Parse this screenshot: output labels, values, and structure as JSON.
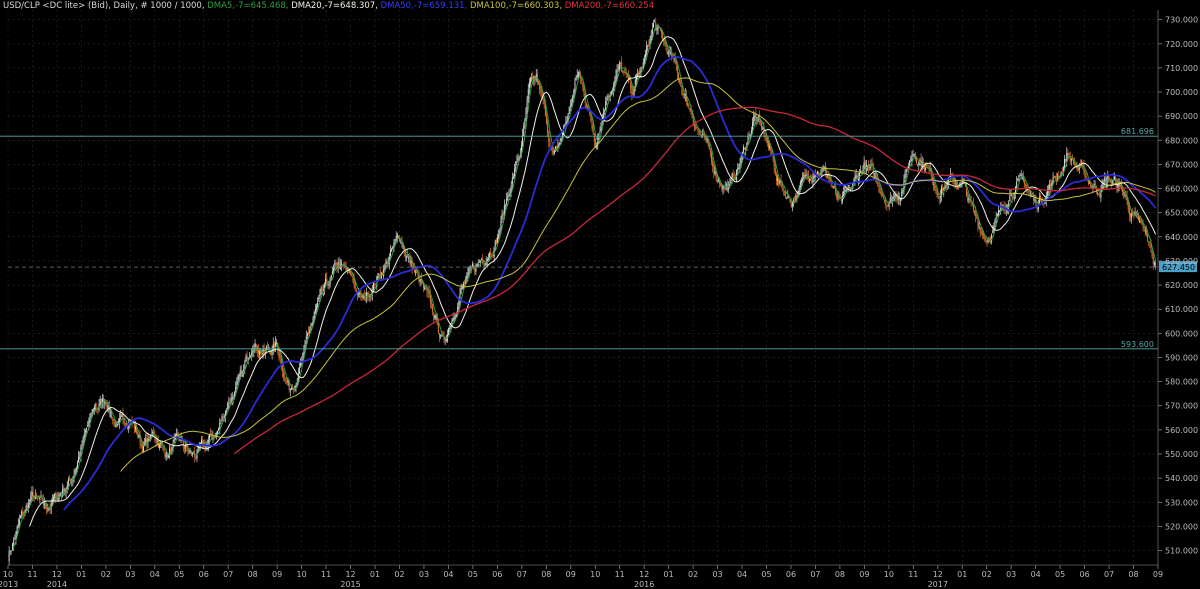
{
  "legend": {
    "title": "USD/CLP <DC lite> (Bid), Daily, # 1000 / 1000,",
    "dma5": "DMA5,-7=645.468,",
    "dma20": "DMA20,-7=648.307,",
    "dma50": "DMA50,-7=659.131,",
    "dma100": "DMA100,-7=660.303,",
    "dma200": "DMA200,-7=660.254"
  },
  "colors": {
    "background": "#000000",
    "grid": "#2a2a2a",
    "candle_up": "#d9d9d9",
    "candle_down": "#e07a2e",
    "dma5": "#2f9e3f",
    "dma20": "#f2f2e6",
    "dma50": "#2b2bd6",
    "dma100": "#c7c23a",
    "dma200": "#c8283a",
    "hline": "#5aa6a6",
    "last_price_box": "#4aa0c8"
  },
  "chart_data": {
    "type": "candlestick",
    "title": "USD/CLP <DC lite> (Bid), Daily",
    "y_ticks": [
      510,
      520,
      530,
      540,
      550,
      560,
      570,
      580,
      590,
      600,
      610,
      620,
      630,
      640,
      650,
      660,
      670,
      680,
      690,
      700,
      710,
      720,
      730
    ],
    "y_tick_labels": [
      "510.000",
      "520.000",
      "530.000",
      "540.000",
      "550.000",
      "560.000",
      "570.000",
      "580.000",
      "590.000",
      "600.000",
      "610.000",
      "620.000",
      "630.000",
      "640.000",
      "650.000",
      "660.000",
      "670.000",
      "680.000",
      "690.000",
      "700.000",
      "710.000",
      "720.000",
      "730.000"
    ],
    "ylim": [
      504,
      734
    ],
    "x_range_months": [
      0,
      47
    ],
    "month_ticks": [
      {
        "m": 0,
        "label": "10"
      },
      {
        "m": 1,
        "label": "11"
      },
      {
        "m": 2,
        "label": "12"
      },
      {
        "m": 3,
        "label": "01"
      },
      {
        "m": 4,
        "label": "02"
      },
      {
        "m": 5,
        "label": "03"
      },
      {
        "m": 6,
        "label": "04"
      },
      {
        "m": 7,
        "label": "05"
      },
      {
        "m": 8,
        "label": "06"
      },
      {
        "m": 9,
        "label": "07"
      },
      {
        "m": 10,
        "label": "08"
      },
      {
        "m": 11,
        "label": "09"
      },
      {
        "m": 12,
        "label": "10"
      },
      {
        "m": 13,
        "label": "11"
      },
      {
        "m": 14,
        "label": "12"
      },
      {
        "m": 15,
        "label": "01"
      },
      {
        "m": 16,
        "label": "02"
      },
      {
        "m": 17,
        "label": "03"
      },
      {
        "m": 18,
        "label": "04"
      },
      {
        "m": 19,
        "label": "05"
      },
      {
        "m": 20,
        "label": "06"
      },
      {
        "m": 21,
        "label": "07"
      },
      {
        "m": 22,
        "label": "08"
      },
      {
        "m": 23,
        "label": "09"
      },
      {
        "m": 24,
        "label": "10"
      },
      {
        "m": 25,
        "label": "11"
      },
      {
        "m": 26,
        "label": "12"
      },
      {
        "m": 27,
        "label": "01"
      },
      {
        "m": 28,
        "label": "02"
      },
      {
        "m": 29,
        "label": "03"
      },
      {
        "m": 30,
        "label": "04"
      },
      {
        "m": 31,
        "label": "05"
      },
      {
        "m": 32,
        "label": "06"
      },
      {
        "m": 33,
        "label": "07"
      },
      {
        "m": 34,
        "label": "08"
      },
      {
        "m": 35,
        "label": "09"
      },
      {
        "m": 36,
        "label": "10"
      },
      {
        "m": 37,
        "label": "11"
      },
      {
        "m": 38,
        "label": "12"
      },
      {
        "m": 39,
        "label": "01"
      },
      {
        "m": 40,
        "label": "02"
      },
      {
        "m": 41,
        "label": "03"
      },
      {
        "m": 42,
        "label": "04"
      },
      {
        "m": 43,
        "label": "05"
      },
      {
        "m": 44,
        "label": "06"
      },
      {
        "m": 45,
        "label": "07"
      },
      {
        "m": 46,
        "label": "08"
      },
      {
        "m": 47,
        "label": "09"
      }
    ],
    "year_labels": [
      {
        "m": 0,
        "label": "2013"
      },
      {
        "m": 2,
        "label": "2014"
      },
      {
        "m": 14,
        "label": "2015"
      },
      {
        "m": 26,
        "label": "2016"
      },
      {
        "m": 38,
        "label": "2017"
      }
    ],
    "price_path": [
      [
        0,
        508
      ],
      [
        0.5,
        522
      ],
      [
        1,
        532
      ],
      [
        1.5,
        527
      ],
      [
        2,
        532
      ],
      [
        2.6,
        540
      ],
      [
        3,
        553
      ],
      [
        3.5,
        568
      ],
      [
        4,
        573
      ],
      [
        4.5,
        560
      ],
      [
        5,
        566
      ],
      [
        5.5,
        553
      ],
      [
        6,
        558
      ],
      [
        6.5,
        550
      ],
      [
        7,
        555
      ],
      [
        7.5,
        549
      ],
      [
        8,
        552
      ],
      [
        8.6,
        560
      ],
      [
        9,
        572
      ],
      [
        9.6,
        582
      ],
      [
        10,
        598
      ],
      [
        10.5,
        592
      ],
      [
        11,
        595
      ],
      [
        11.5,
        577
      ],
      [
        12,
        588
      ],
      [
        12.5,
        607
      ],
      [
        13,
        618
      ],
      [
        13.5,
        628
      ],
      [
        14,
        623
      ],
      [
        14.5,
        613
      ],
      [
        15,
        622
      ],
      [
        15.5,
        630
      ],
      [
        16,
        640
      ],
      [
        16.5,
        628
      ],
      [
        17,
        617
      ],
      [
        17.5,
        605
      ],
      [
        17.8,
        595
      ],
      [
        18,
        603
      ],
      [
        18.5,
        618
      ],
      [
        19,
        625
      ],
      [
        19.5,
        633
      ],
      [
        20,
        640
      ],
      [
        20.5,
        660
      ],
      [
        21,
        678
      ],
      [
        21.3,
        700
      ],
      [
        21.6,
        705
      ],
      [
        22,
        688
      ],
      [
        22.3,
        672
      ],
      [
        22.6,
        680
      ],
      [
        23,
        695
      ],
      [
        23.3,
        708
      ],
      [
        23.6,
        698
      ],
      [
        24,
        680
      ],
      [
        24.5,
        700
      ],
      [
        25,
        710
      ],
      [
        25.5,
        700
      ],
      [
        26,
        712
      ],
      [
        26.4,
        728
      ],
      [
        26.8,
        720
      ],
      [
        27.2,
        712
      ],
      [
        27.6,
        700
      ],
      [
        28,
        690
      ],
      [
        28.5,
        678
      ],
      [
        29,
        665
      ],
      [
        29.5,
        660
      ],
      [
        30,
        673
      ],
      [
        30.5,
        690
      ],
      [
        31,
        680
      ],
      [
        31.5,
        663
      ],
      [
        32,
        655
      ],
      [
        32.5,
        662
      ],
      [
        33,
        670
      ],
      [
        33.5,
        666
      ],
      [
        34,
        652
      ],
      [
        34.5,
        660
      ],
      [
        35,
        670
      ],
      [
        35.5,
        663
      ],
      [
        36,
        655
      ],
      [
        36.5,
        660
      ],
      [
        37,
        676
      ],
      [
        37.5,
        670
      ],
      [
        38,
        660
      ],
      [
        38.5,
        663
      ],
      [
        39,
        662
      ],
      [
        39.5,
        648
      ],
      [
        40,
        640
      ],
      [
        40.5,
        648
      ],
      [
        41,
        660
      ],
      [
        41.5,
        663
      ],
      [
        42,
        653
      ],
      [
        42.5,
        660
      ],
      [
        43,
        667
      ],
      [
        43.3,
        675
      ],
      [
        43.6,
        670
      ],
      [
        44,
        665
      ],
      [
        44.5,
        660
      ],
      [
        45,
        664
      ],
      [
        45.5,
        660
      ],
      [
        46,
        648
      ],
      [
        46.5,
        640
      ],
      [
        46.9,
        627.45
      ]
    ],
    "series": [
      {
        "name": "DMA5",
        "value_last": 645.468
      },
      {
        "name": "DMA20",
        "value_last": 648.307
      },
      {
        "name": "DMA50",
        "value_last": 659.131
      },
      {
        "name": "DMA100",
        "value_last": 660.303
      },
      {
        "name": "DMA200",
        "value_last": 660.254
      }
    ],
    "horizontal_lines": [
      {
        "value": 681.696,
        "label": "681.696"
      },
      {
        "value": 593.6,
        "label": "593.600"
      }
    ],
    "last_price": {
      "value": 627.45,
      "label": "627.450"
    }
  }
}
